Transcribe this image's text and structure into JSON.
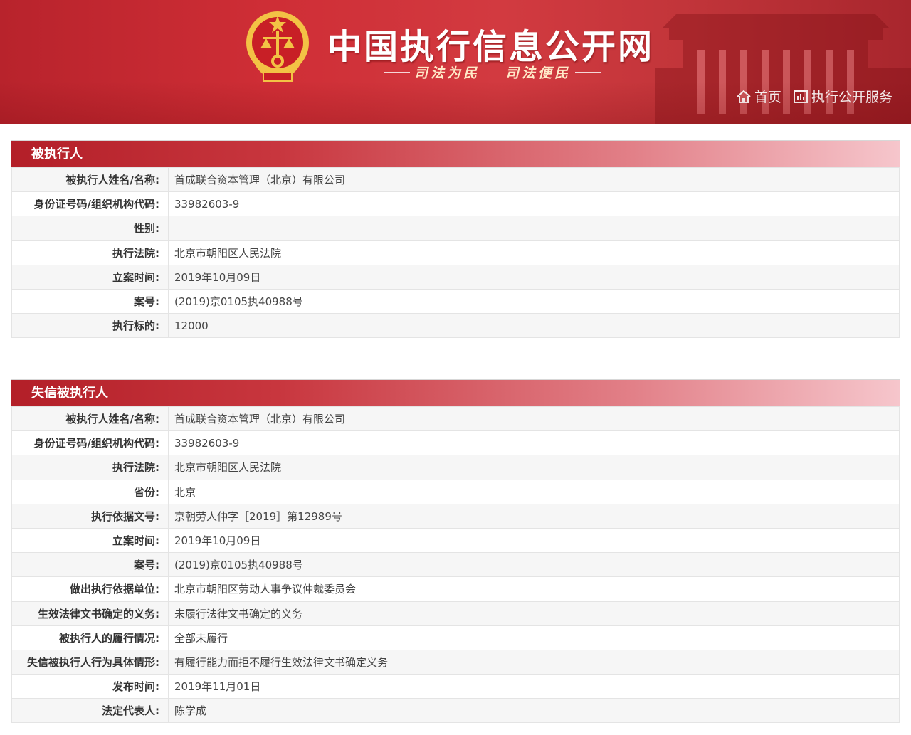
{
  "header": {
    "site_title": "中国执行信息公开网",
    "slogan_left": "司法为民",
    "slogan_right": "司法便民",
    "nav": [
      {
        "label": "首页",
        "icon": "home-icon"
      },
      {
        "label": "执行公开服务",
        "icon": "chart-icon"
      }
    ]
  },
  "executed_person": {
    "title": "被执行人",
    "rows": [
      {
        "label": "被执行人姓名/名称:",
        "value": "首成联合资本管理（北京）有限公司"
      },
      {
        "label": "身份证号码/组织机构代码:",
        "value": "33982603-9"
      },
      {
        "label": "性别:",
        "value": ""
      },
      {
        "label": "执行法院:",
        "value": "北京市朝阳区人民法院"
      },
      {
        "label": "立案时间:",
        "value": "2019年10月09日"
      },
      {
        "label": "案号:",
        "value": "(2019)京0105执40988号"
      },
      {
        "label": "执行标的:",
        "value": "12000"
      }
    ]
  },
  "dishonest_person": {
    "title": "失信被执行人",
    "rows": [
      {
        "label": "被执行人姓名/名称:",
        "value": "首成联合资本管理（北京）有限公司"
      },
      {
        "label": "身份证号码/组织机构代码:",
        "value": "33982603-9"
      },
      {
        "label": "执行法院:",
        "value": "北京市朝阳区人民法院"
      },
      {
        "label": "省份:",
        "value": "北京"
      },
      {
        "label": "执行依据文号:",
        "value": "京朝劳人仲字［2019］第12989号"
      },
      {
        "label": "立案时间:",
        "value": "2019年10月09日"
      },
      {
        "label": "案号:",
        "value": "(2019)京0105执40988号"
      },
      {
        "label": "做出执行依据单位:",
        "value": "北京市朝阳区劳动人事争议仲裁委员会"
      },
      {
        "label": "生效法律文书确定的义务:",
        "value": "未履行法律文书确定的义务"
      },
      {
        "label": "被执行人的履行情况:",
        "value": "全部未履行"
      },
      {
        "label": "失信被执行人行为具体情形:",
        "value": "有履行能力而拒不履行生效法律文书确定义务"
      },
      {
        "label": "发布时间:",
        "value": "2019年11月01日"
      },
      {
        "label": "法定代表人:",
        "value": "陈学成"
      }
    ]
  },
  "colors": {
    "banner_red": "#cf2e36",
    "panel_head_start": "#b31f28",
    "panel_head_end": "#f6c6cc",
    "slogan_gold": "#ffe9c8"
  }
}
